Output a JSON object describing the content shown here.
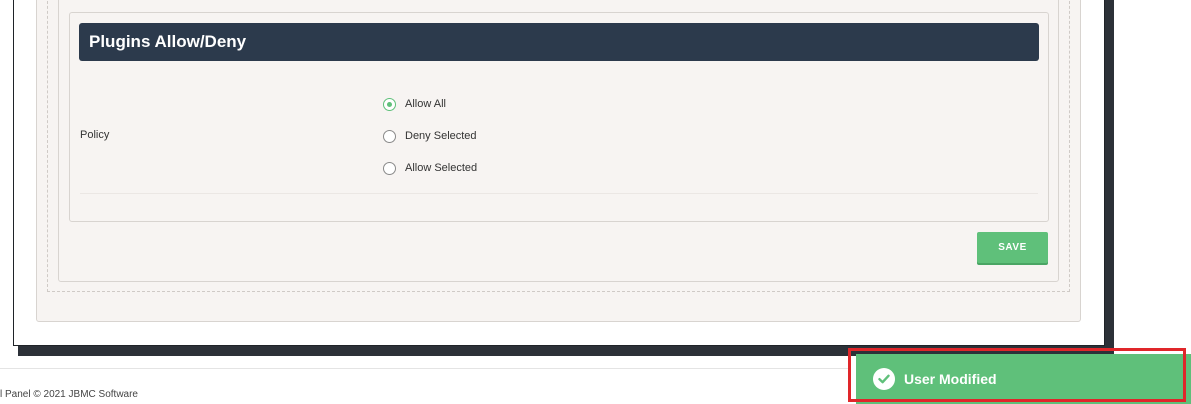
{
  "section": {
    "title": "Plugins Allow/Deny"
  },
  "policy": {
    "label": "Policy",
    "options": [
      {
        "label": "Allow All",
        "selected": true
      },
      {
        "label": "Deny Selected",
        "selected": false
      },
      {
        "label": "Allow Selected",
        "selected": false
      }
    ]
  },
  "actions": {
    "save_label": "SAVE"
  },
  "footer": {
    "text": "l Panel © 2021 JBMC Software"
  },
  "toast": {
    "message": "User Modified",
    "icon": "check-circle-icon"
  },
  "colors": {
    "header_bg": "#2c3a4c",
    "accent_green": "#5fc07a",
    "highlight_red": "#e0262a",
    "panel_bg": "#f7f4f2"
  }
}
